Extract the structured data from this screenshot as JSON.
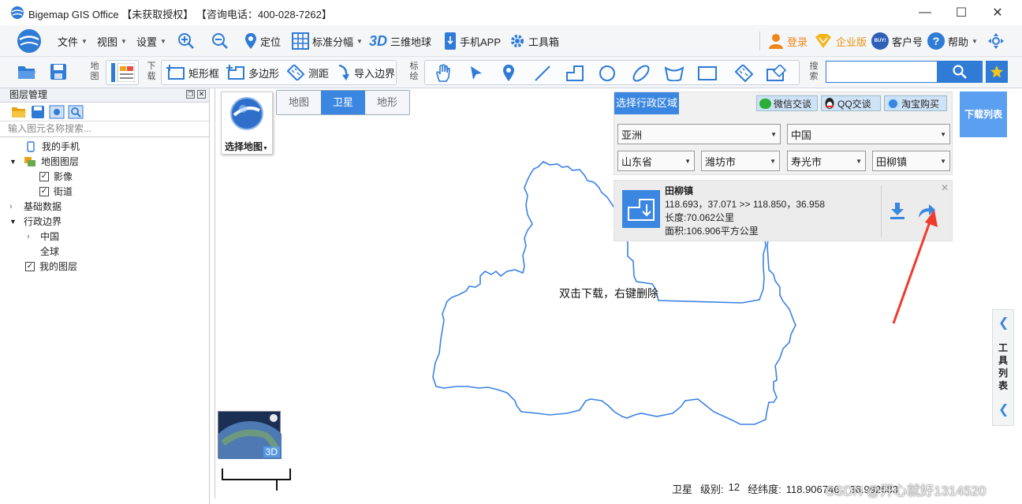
{
  "window": {
    "title": "Bigemap GIS Office 【未获取授权】 【咨询电话：400-028-7262】",
    "controls": {
      "minimize": "—",
      "maximize": "☐",
      "close": "✕"
    }
  },
  "toolbar1": {
    "file": "文件",
    "view": "视图",
    "settings": "设置",
    "locate": "定位",
    "standard_sheet": "标准分幅",
    "globe3d_badge": "3D",
    "globe3d": "三维地球",
    "mobile_app": "手机APP",
    "toolbox": "工具箱",
    "login": "登录",
    "enterprise": "企业版",
    "buy_badge": "BUY!",
    "customer_no": "客户号",
    "help": "帮助"
  },
  "toolbar2": {
    "map_group_label": [
      "地",
      "图"
    ],
    "download_group_label": [
      "下",
      "载"
    ],
    "rect_frame": "矩形框",
    "polygon": "多边形",
    "measure": "测距",
    "import_boundary": "导入边界",
    "annotate_group_label": [
      "标",
      "绘"
    ],
    "search_group_label": [
      "搜",
      "索"
    ],
    "search_value": ""
  },
  "left_panel": {
    "title": "图层管理",
    "search_placeholder": "输入图元名称搜索...",
    "tree": {
      "my_phone": "我的手机",
      "map_layers": "地图图层",
      "imagery": "影像",
      "streets": "街道",
      "basic_data": "基础数据",
      "admin_boundary": "行政边界",
      "china": "中国",
      "global": "全球",
      "my_layers": "我的图层"
    }
  },
  "map": {
    "choose_map": "选择地图",
    "tabs": {
      "map": "地图",
      "satellite": "卫星",
      "terrain": "地形"
    },
    "active_tab": "卫星",
    "boundary_hint": "双击下载，右键删除",
    "minimap_badge": "3D",
    "boundary_color": "#3b82e6"
  },
  "region_panel": {
    "title": "选择行政区域",
    "wechat": "微信交谈",
    "qq": "QQ交谈",
    "taobao": "淘宝购买",
    "continent": "亚洲",
    "country": "中国",
    "province": "山东省",
    "city": "潍坊市",
    "county": "寿光市",
    "town": "田柳镇"
  },
  "result_card": {
    "name": "田柳镇",
    "coords": "118.693，37.071 >> 118.850，36.958",
    "length": "长度:70.062公里",
    "area": "面积:106.906平方公里"
  },
  "download_list": "下载列表",
  "tool_list": [
    "工",
    "具",
    "列",
    "表"
  ],
  "status": {
    "map_type": "卫星",
    "level_label": "级别:",
    "level_value": "12",
    "lonlat_label": "经纬度:",
    "lonlat_value": "118.906746，36.992683"
  },
  "watermark": "CSDN @开心就好1314520",
  "colors": {
    "accent": "#3a86e0",
    "annotation_arrow": "#f03a2e",
    "login_orange": "#f0861a"
  }
}
